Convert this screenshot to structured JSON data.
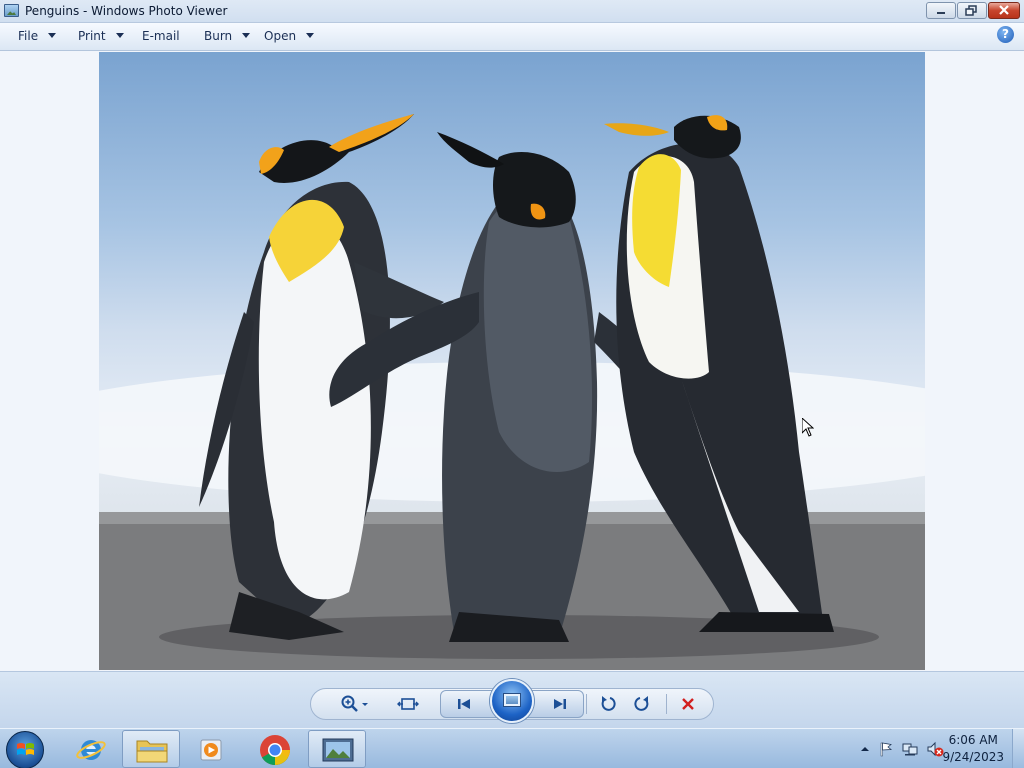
{
  "window": {
    "title": "Penguins - Windows Photo Viewer",
    "controls": {
      "minimize": "minimize",
      "maximize": "restore",
      "close": "close"
    }
  },
  "menu": [
    {
      "label": "File",
      "has_dropdown": true
    },
    {
      "label": "Print",
      "has_dropdown": true
    },
    {
      "label": "E-mail",
      "has_dropdown": false
    },
    {
      "label": "Burn",
      "has_dropdown": true
    },
    {
      "label": "Open",
      "has_dropdown": true
    }
  ],
  "help": {
    "icon": "help-icon",
    "glyph": "?"
  },
  "image": {
    "subject": "Penguins",
    "description": "three king penguins on a beach"
  },
  "controls": [
    {
      "name": "zoom",
      "icon": "zoom-icon"
    },
    {
      "name": "actual-size",
      "icon": "fit-icon"
    },
    {
      "name": "previous",
      "icon": "previous-icon"
    },
    {
      "name": "slideshow",
      "icon": "slideshow-icon"
    },
    {
      "name": "next",
      "icon": "next-icon"
    },
    {
      "name": "rotate-left",
      "icon": "rotate-ccw-icon"
    },
    {
      "name": "rotate-right",
      "icon": "rotate-cw-icon"
    },
    {
      "name": "delete",
      "icon": "delete-icon"
    }
  ],
  "taskbar": {
    "apps": [
      {
        "name": "internet-explorer",
        "icon": "ie-icon"
      },
      {
        "name": "windows-explorer",
        "icon": "folder-icon"
      },
      {
        "name": "media-player",
        "icon": "media-player-icon"
      },
      {
        "name": "chrome",
        "icon": "chrome-icon"
      },
      {
        "name": "photo-viewer",
        "icon": "photo-viewer-icon",
        "active": true
      }
    ],
    "tray_icons": [
      "show-hidden-icons-icon",
      "action-center-icon",
      "network-icon",
      "volume-muted-icon"
    ],
    "time": "6:06 AM",
    "date": "9/24/2023"
  },
  "colors": {
    "accent": "#1d63c6",
    "close": "#c7452d",
    "delete": "#d21f1f"
  }
}
